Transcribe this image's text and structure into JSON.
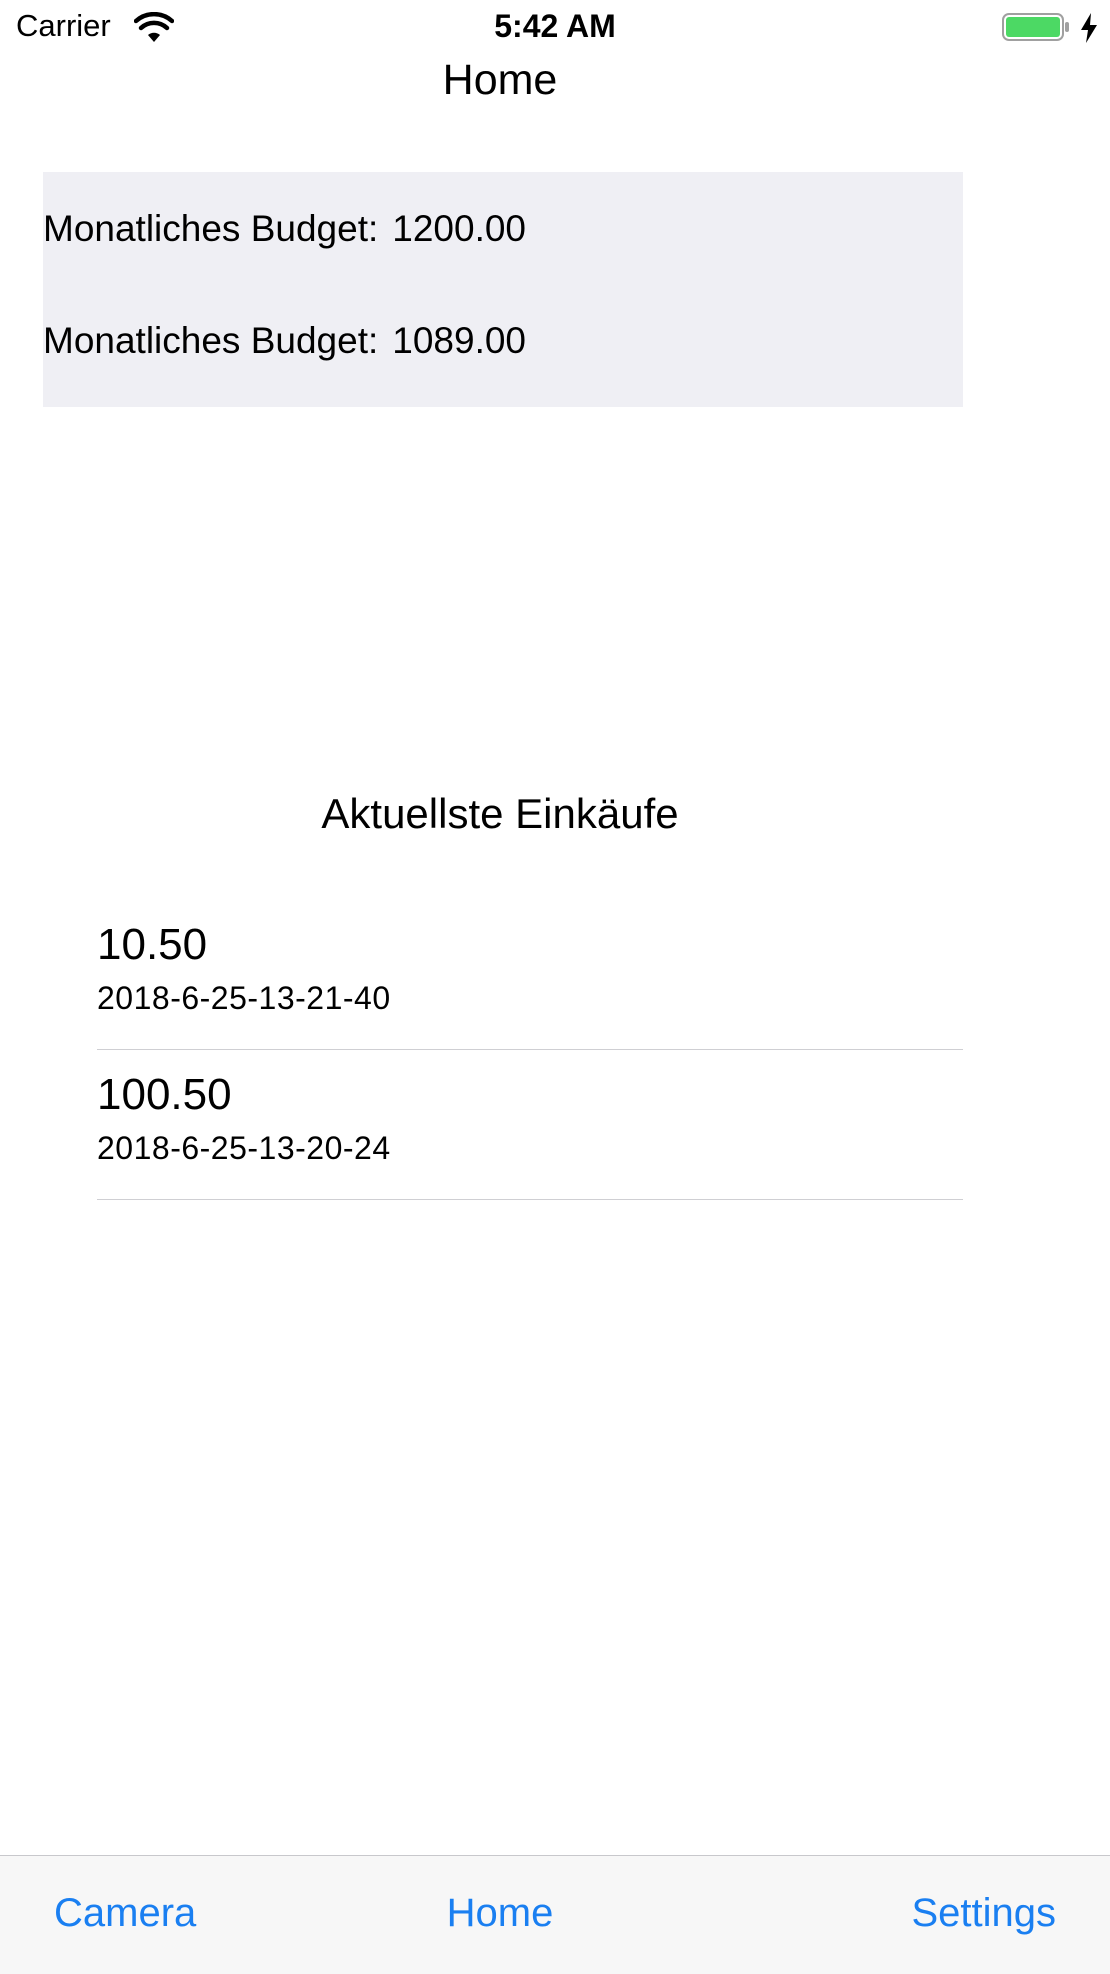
{
  "status_bar": {
    "carrier": "Carrier",
    "time": "5:42 AM",
    "icons": [
      "wifi-icon",
      "battery-icon",
      "charging-bolt-icon"
    ],
    "battery_color": "#4cd964"
  },
  "nav": {
    "title": "Home"
  },
  "budget": {
    "rows": [
      {
        "label": "Monatliches Budget:",
        "value": "1200.00"
      },
      {
        "label": "Monatliches Budget:",
        "value": "1089.00"
      }
    ]
  },
  "recent": {
    "title": "Aktuellste Einkäufe",
    "items": [
      {
        "amount": "10.50",
        "date": "2018-6-25-13-21-40"
      },
      {
        "amount": "100.50",
        "date": "2018-6-25-13-20-24"
      }
    ]
  },
  "tab_bar": {
    "accent_color": "#1a7ff1",
    "tabs": [
      {
        "label": "Camera"
      },
      {
        "label": "Home"
      },
      {
        "label": "Settings"
      }
    ]
  }
}
